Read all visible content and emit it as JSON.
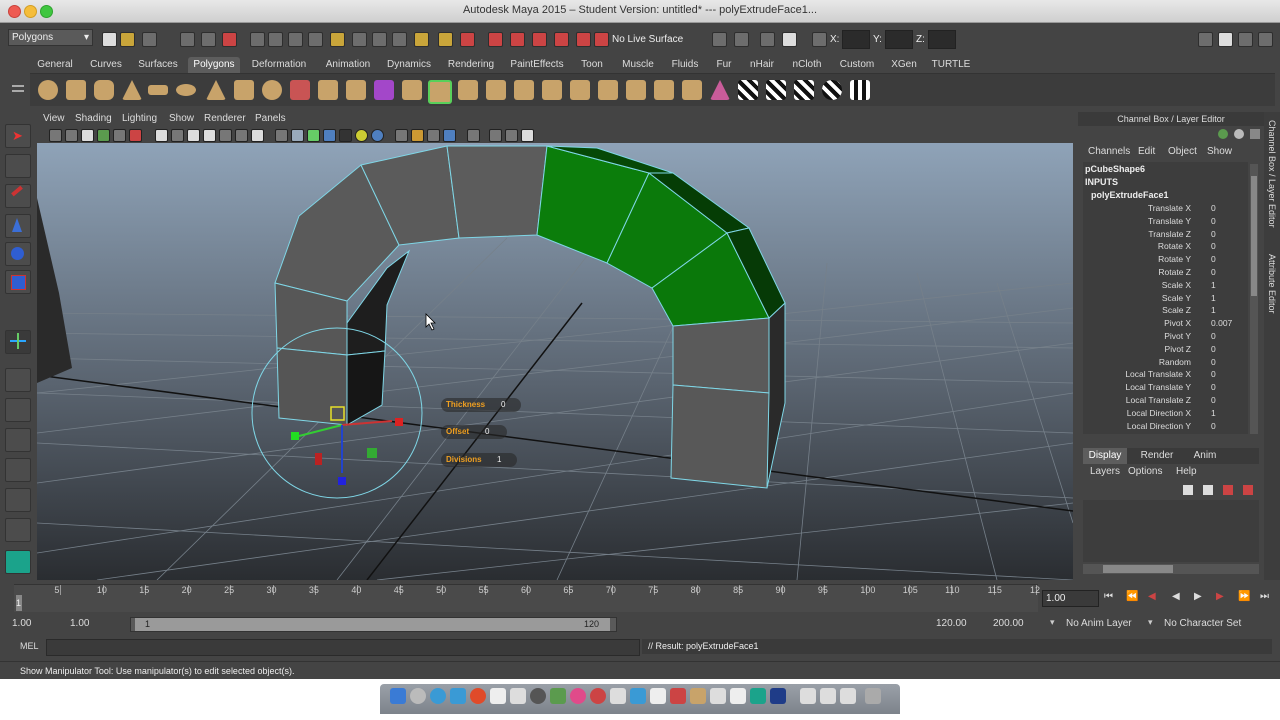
{
  "window": {
    "title": "Autodesk Maya 2015 – Student Version: untitled*   ---   polyExtrudeFace1..."
  },
  "status_line": {
    "menu_set": "Polygons",
    "live_surface": "No Live Surface",
    "x_label": "X:",
    "y_label": "Y:",
    "z_label": "Z:"
  },
  "shelf_tabs": [
    "General",
    "Curves",
    "Surfaces",
    "Polygons",
    "Deformation",
    "Animation",
    "Dynamics",
    "Rendering",
    "PaintEffects",
    "Toon",
    "Muscle",
    "Fluids",
    "Fur",
    "nHair",
    "nCloth",
    "Custom",
    "XGen",
    "TURTLE"
  ],
  "shelf_active": "Polygons",
  "viewport": {
    "menus": [
      "View",
      "Shading",
      "Lighting",
      "Show",
      "Renderer",
      "Panels"
    ],
    "hud": [
      {
        "label": "Thickness",
        "value": "0"
      },
      {
        "label": "Offset",
        "value": "0"
      },
      {
        "label": "Divisions",
        "value": "1"
      }
    ]
  },
  "channel_box": {
    "title": "Channel Box / Layer Editor",
    "menus": [
      "Channels",
      "Edit",
      "Object",
      "Show"
    ],
    "shape": "pCubeShape6",
    "inputs_label": "INPUTS",
    "node": "polyExtrudeFace1",
    "attributes": [
      {
        "name": "Translate X",
        "value": "0"
      },
      {
        "name": "Translate Y",
        "value": "0"
      },
      {
        "name": "Translate Z",
        "value": "0"
      },
      {
        "name": "Rotate X",
        "value": "0"
      },
      {
        "name": "Rotate Y",
        "value": "0"
      },
      {
        "name": "Rotate Z",
        "value": "0"
      },
      {
        "name": "Scale X",
        "value": "1"
      },
      {
        "name": "Scale Y",
        "value": "1"
      },
      {
        "name": "Scale Z",
        "value": "1"
      },
      {
        "name": "Pivot X",
        "value": "0.007"
      },
      {
        "name": "Pivot Y",
        "value": "0"
      },
      {
        "name": "Pivot Z",
        "value": "0"
      },
      {
        "name": "Random",
        "value": "0"
      },
      {
        "name": "Local Translate X",
        "value": "0"
      },
      {
        "name": "Local Translate Y",
        "value": "0"
      },
      {
        "name": "Local Translate Z",
        "value": "0"
      },
      {
        "name": "Local Direction X",
        "value": "1"
      },
      {
        "name": "Local Direction Y",
        "value": "0"
      }
    ],
    "layer_tabs": [
      "Display",
      "Render",
      "Anim"
    ],
    "layer_menus": [
      "Layers",
      "Options",
      "Help"
    ]
  },
  "side_tabs": [
    "Channel Box / Layer Editor",
    "Attribute Editor"
  ],
  "time_slider": {
    "ticks": [
      "5",
      "10",
      "15",
      "20",
      "25",
      "30",
      "35",
      "40",
      "45",
      "50",
      "55",
      "60",
      "65",
      "70",
      "75",
      "80",
      "85",
      "90",
      "95",
      "100",
      "105",
      "110",
      "115",
      "12"
    ],
    "current_frame_marker": "1",
    "current_time": "1.00"
  },
  "range_slider": {
    "start_time": "1.00",
    "playback_start": "1.00",
    "range_start_label": "1",
    "range_end_label": "120",
    "playback_end": "120.00",
    "end_time": "200.00",
    "anim_layer": "No Anim Layer",
    "character_set": "No Character Set"
  },
  "command_line": {
    "language": "MEL",
    "result": "// Result: polyExtrudeFace1"
  },
  "help_line": "Show Manipulator Tool: Use manipulator(s) to edit selected object(s).",
  "colors": {
    "selected_faces": "#0b7d0b",
    "wireframe_highlight": "#7fd6e6",
    "viewport_top": "#8fa3b8",
    "viewport_bottom": "#2a2d31"
  }
}
